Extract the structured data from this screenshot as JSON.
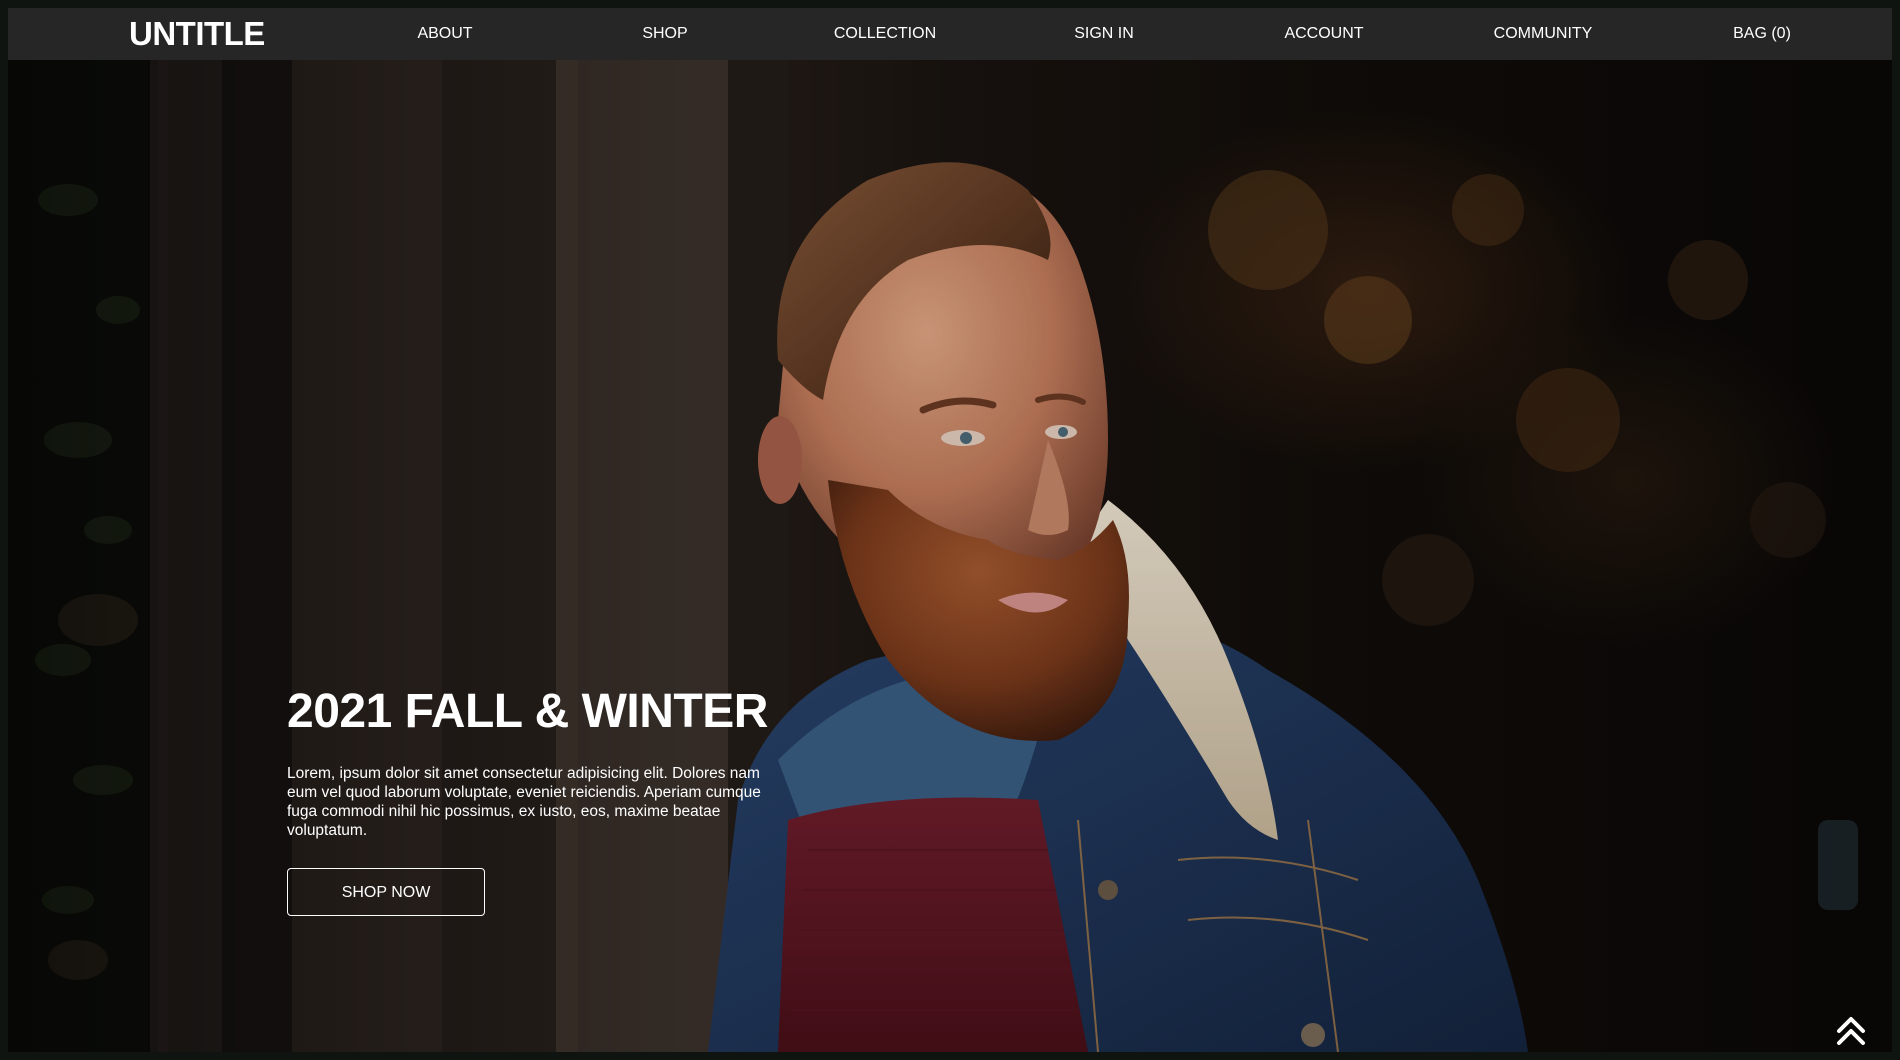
{
  "brand": {
    "logo": "UNTITLE"
  },
  "nav": {
    "items": [
      {
        "label": "ABOUT"
      },
      {
        "label": "SHOP"
      },
      {
        "label": "COLLECTION"
      },
      {
        "label": "SIGN IN"
      },
      {
        "label": "ACCOUNT"
      },
      {
        "label": "COMMUNITY"
      },
      {
        "label": "BAG (0)"
      }
    ]
  },
  "hero": {
    "title": "2021 FALL & WINTER",
    "text": "Lorem, ipsum dolor sit amet consectetur adipisicing elit. Dolores nam eum vel quod laborum voluptate, eveniet reiciendis. Aperiam cumque fuga commodi nihil hic possimus, ex iusto, eos, maxime beatae voluptatum.",
    "button_label": "SHOP NOW",
    "image": "hero-photo-man-denim-jacket"
  },
  "scroll_top": {
    "icon": "double-chevron-up-icon"
  },
  "colors": {
    "navbar_bg": "#262626",
    "frame_border": "#0f1410",
    "text": "#ffffff"
  }
}
